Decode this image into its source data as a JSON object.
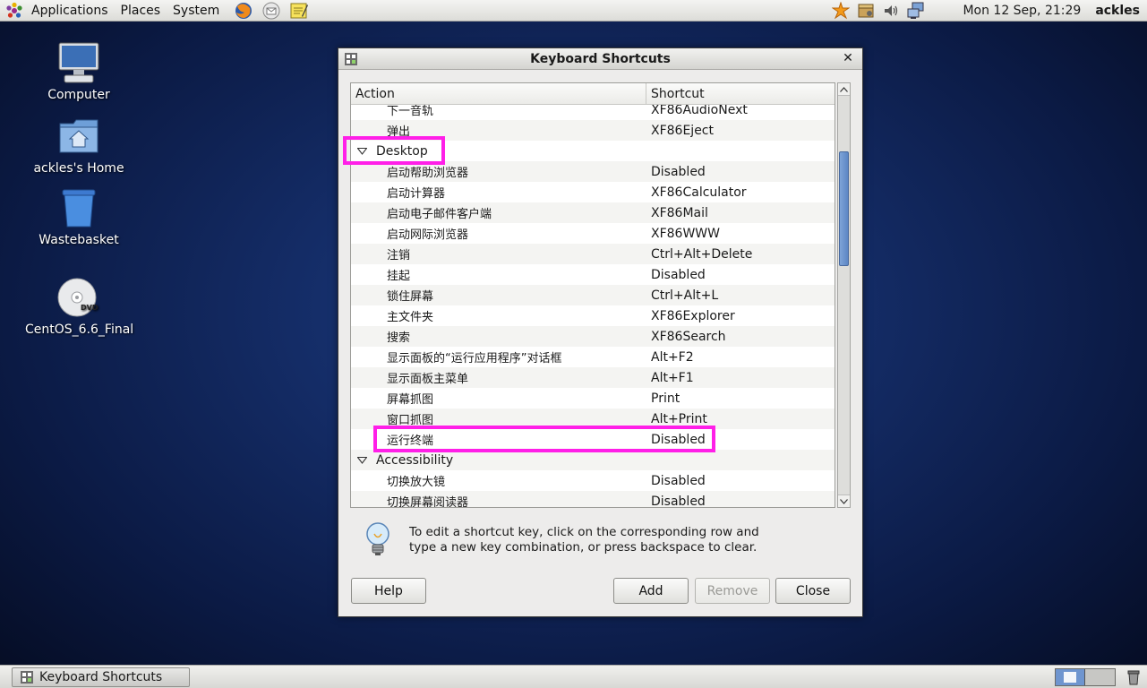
{
  "top_panel": {
    "menu": [
      "Applications",
      "Places",
      "System"
    ],
    "clock": "Mon 12 Sep, 21:29",
    "user": "ackles"
  },
  "desktop_icons": [
    {
      "label": "Computer",
      "icon": "computer-icon"
    },
    {
      "label": "ackles's Home",
      "icon": "home-folder-icon"
    },
    {
      "label": "Wastebasket",
      "icon": "wastebasket-icon"
    },
    {
      "label": "CentOS_6.6_Final",
      "icon": "dvd-icon",
      "badge": "DVD"
    }
  ],
  "window": {
    "title": "Keyboard Shortcuts",
    "columns": {
      "action": "Action",
      "shortcut": "Shortcut"
    },
    "rows": [
      {
        "type": "child",
        "action": "下一音轨",
        "shortcut": "XF86AudioNext"
      },
      {
        "type": "child",
        "action": "弹出",
        "shortcut": "XF86Eject"
      },
      {
        "type": "group",
        "action": "Desktop",
        "shortcut": ""
      },
      {
        "type": "child",
        "action": "启动帮助浏览器",
        "shortcut": "Disabled"
      },
      {
        "type": "child",
        "action": "启动计算器",
        "shortcut": "XF86Calculator"
      },
      {
        "type": "child",
        "action": "启动电子邮件客户端",
        "shortcut": "XF86Mail"
      },
      {
        "type": "child",
        "action": "启动网际浏览器",
        "shortcut": "XF86WWW"
      },
      {
        "type": "child",
        "action": "注销",
        "shortcut": "Ctrl+Alt+Delete"
      },
      {
        "type": "child",
        "action": "挂起",
        "shortcut": "Disabled"
      },
      {
        "type": "child",
        "action": "锁住屏幕",
        "shortcut": "Ctrl+Alt+L"
      },
      {
        "type": "child",
        "action": "主文件夹",
        "shortcut": "XF86Explorer"
      },
      {
        "type": "child",
        "action": "搜索",
        "shortcut": "XF86Search"
      },
      {
        "type": "child",
        "action": "显示面板的“运行应用程序”对话框",
        "shortcut": "Alt+F2"
      },
      {
        "type": "child",
        "action": "显示面板主菜单",
        "shortcut": "Alt+F1"
      },
      {
        "type": "child",
        "action": "屏幕抓图",
        "shortcut": "Print"
      },
      {
        "type": "child",
        "action": "窗口抓图",
        "shortcut": "Alt+Print"
      },
      {
        "type": "child",
        "action": "运行终端",
        "shortcut": "Disabled"
      },
      {
        "type": "group",
        "action": "Accessibility",
        "shortcut": ""
      },
      {
        "type": "child",
        "action": "切换放大镜",
        "shortcut": "Disabled"
      },
      {
        "type": "child",
        "action": "切换屏幕阅读器",
        "shortcut": "Disabled"
      }
    ],
    "hint": "To edit a shortcut key, click on the corresponding row and type a new key combination, or press backspace to clear.",
    "buttons": {
      "help": "Help",
      "add": "Add",
      "remove": "Remove",
      "close": "Close"
    }
  },
  "taskbar": {
    "task_label": "Keyboard Shortcuts"
  },
  "colors": {
    "highlight": "#ff1fe8",
    "desktop": "#142c66"
  }
}
